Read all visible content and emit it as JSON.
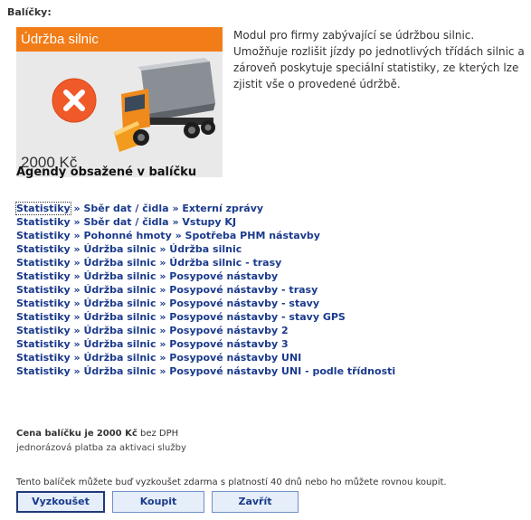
{
  "section_label": "Balíčky:",
  "package": {
    "title": "Údržba silnic",
    "price": "2000 Kč",
    "description": "Modul pro firmy zabývající se údržbou silnic. Umožňuje rozlišit jízdy po jednotlivých třídách silnic a zároveň poskytuje speciální statistiky, ze kterých lze zjistit vše o provedené údržbě.",
    "icon": "close-circle-icon",
    "colors": {
      "card_header": "#f27c17",
      "icon": "#f05a28",
      "link": "#1a3a8c"
    }
  },
  "agendas": {
    "heading": "Agendy obsažené v balíčku",
    "separator": "»",
    "items": [
      {
        "path": [
          "Statistiky",
          "Sběr dat / čidla",
          "Externí zprávy"
        ]
      },
      {
        "path": [
          "Statistiky",
          "Sběr dat / čidla",
          "Vstupy KJ"
        ]
      },
      {
        "path": [
          "Statistiky",
          "Pohonné hmoty",
          "Spotřeba PHM nástavby"
        ]
      },
      {
        "path": [
          "Statistiky",
          "Údržba silnic",
          "Údržba silnic"
        ]
      },
      {
        "path": [
          "Statistiky",
          "Údržba silnic",
          "Údržba silnic - trasy"
        ]
      },
      {
        "path": [
          "Statistiky",
          "Údržba silnic",
          "Posypové nástavby"
        ]
      },
      {
        "path": [
          "Statistiky",
          "Údržba silnic",
          "Posypové nástavby - trasy"
        ]
      },
      {
        "path": [
          "Statistiky",
          "Údržba silnic",
          "Posypové nástavby - stavy"
        ]
      },
      {
        "path": [
          "Statistiky",
          "Údržba silnic",
          "Posypové nástavby - stavy GPS"
        ]
      },
      {
        "path": [
          "Statistiky",
          "Údržba silnic",
          "Posypové nástavby 2"
        ]
      },
      {
        "path": [
          "Statistiky",
          "Údržba silnic",
          "Posypové nástavby 3"
        ]
      },
      {
        "path": [
          "Statistiky",
          "Údržba silnic",
          "Posypové nástavby UNI"
        ]
      },
      {
        "path": [
          "Statistiky",
          "Údržba silnic",
          "Posypové nástavby UNI - podle třídnosti"
        ]
      }
    ]
  },
  "pricing": {
    "price_prefix": "Cena balíčku je",
    "price_value": "2000 Kč",
    "price_suffix": "bez DPH",
    "subline": "jednorázová platba za aktivaci služby"
  },
  "trial_text": "Tento balíček můžete buď vyzkoušet zdarma s platností 40 dnů nebo ho můžete rovnou koupit.",
  "buttons": {
    "try": "Vyzkoušet",
    "buy": "Koupit",
    "close": "Zavřít"
  }
}
